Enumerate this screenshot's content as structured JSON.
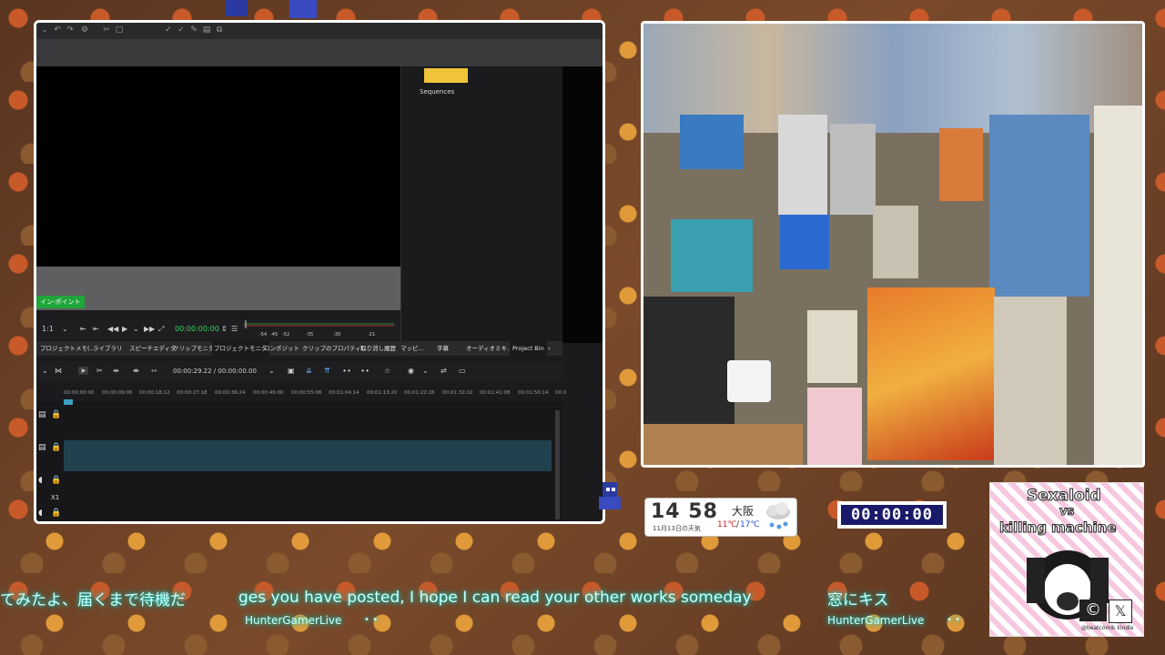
{
  "editor": {
    "bin_label": "Sequences",
    "in_point_label": "イン-ポイント",
    "transport": {
      "zoom": "1:1",
      "timecode": "00:00:00:00",
      "meter_labels": [
        "-54",
        "-45",
        "-52",
        "-35",
        "-30",
        "-21"
      ]
    },
    "tabs": [
      "プロジェクトメモ(...",
      "ライブラリ",
      "スピーチエディタ",
      "クリップモニタ",
      "プロジェクトモニタ",
      "コンポジット",
      "クリップのプロパティ(...",
      "取り消し履歴",
      "マッピ...",
      "字幕",
      "オーディオミキ...",
      "Project Bin"
    ],
    "timeline_position": "00:00:29.22 / 00:00:00.00",
    "ruler_ticks": [
      "00:00:00:00",
      "00:00:09:06",
      "00:00:18:12",
      "00:00:27:18",
      "00:00:36:24",
      "00:00:46:00",
      "00:00:55:06",
      "00:01:04:14",
      "00:01:13:20",
      "00:01:22:26",
      "00:01:32:02",
      "00:01:41:08",
      "00:01:50:14",
      "00:0"
    ],
    "track_extra": "X1"
  },
  "clock": {
    "time": "14 58",
    "date": "11月13日の天気",
    "city": "大阪",
    "temp_high": "11℃",
    "temp_low": "17℃"
  },
  "timer": {
    "display": "00:00:00"
  },
  "chat": [
    {
      "text": "てみたよ、届くまで待機だ",
      "user": ""
    },
    {
      "text": "ges you have posted, I hope I can read your other works someday",
      "user": "HunterGamerLive"
    },
    {
      "text": "窓にキス",
      "user": "HunterGamerLive"
    }
  ],
  "album": {
    "title_line1": "Sexaloid",
    "title_line2": "vs",
    "title_line3": "killing machine",
    "credit": "@beatcomik kindle"
  },
  "colors": {
    "chat_glow": "#00e0d0",
    "in_point": "#1fa53a",
    "bin_thumb": "#f0c43a",
    "track_highlight": "#22414f",
    "timer_bg": "#1a1a6a"
  }
}
